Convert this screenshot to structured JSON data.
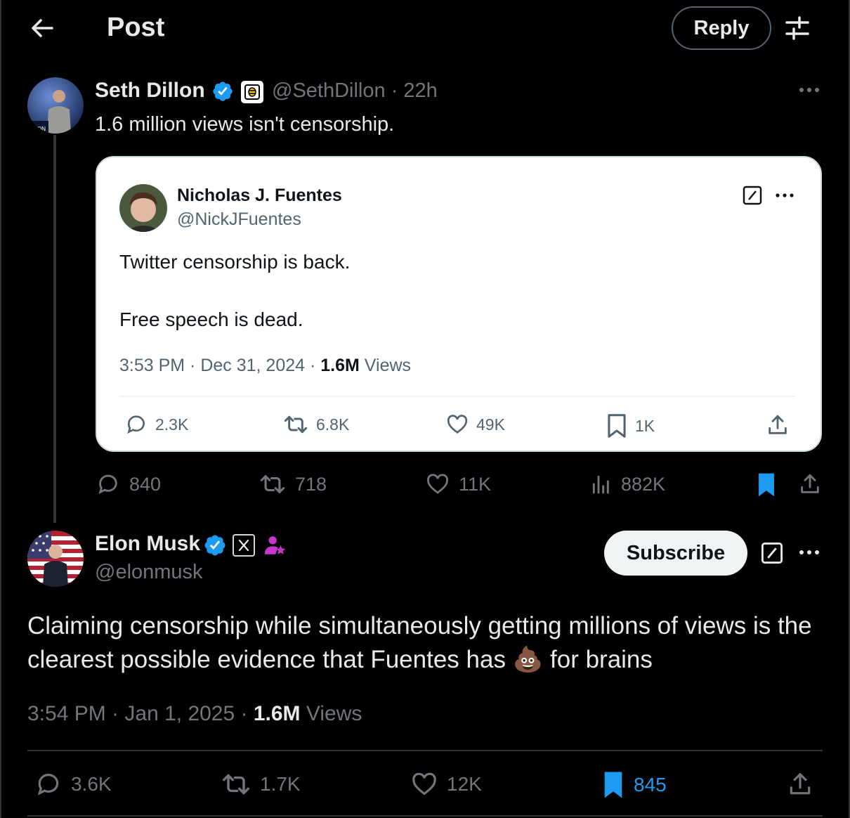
{
  "header": {
    "title": "Post",
    "reply_label": "Reply"
  },
  "parent_post": {
    "author_name": "Seth Dillon",
    "handle": "@SethDillon",
    "separator": "·",
    "time_ago": "22h",
    "text": "1.6 million views isn't censorship.",
    "stats": {
      "replies": "840",
      "reposts": "718",
      "likes": "11K",
      "views": "882K"
    }
  },
  "quoted_post": {
    "author_name": "Nicholas J. Fuentes",
    "handle": "@NickJFuentes",
    "line1": "Twitter censorship is back.",
    "line2": "Free speech is dead.",
    "timestamp": "3:53 PM · Dec 31, 2024 · ",
    "views_count": "1.6M",
    "views_label": " Views",
    "stats": {
      "replies": "2.3K",
      "reposts": "6.8K",
      "likes": "49K",
      "bookmarks": "1K"
    }
  },
  "main_post": {
    "author_name": "Elon Musk",
    "handle": "@elonmusk",
    "subscribe_label": "Subscribe",
    "text_line1": "Claiming censorship while simultaneously getting millions of views is the",
    "text_line2_before": "clearest possible evidence that Fuentes has ",
    "emoji": "💩",
    "text_line2_after": " for brains",
    "timestamp": "3:54 PM · Jan 1, 2025 · ",
    "views_count": "1.6M",
    "views_label": " Views",
    "stats": {
      "replies": "3.6K",
      "reposts": "1.7K",
      "likes": "12K",
      "bookmarks": "845"
    }
  },
  "colors": {
    "background": "#000000",
    "accent_blue": "#1d9bf0",
    "muted": "#71767b",
    "verified": "#1d9bf0",
    "affiliate_pink": "#c936cc"
  },
  "icons": [
    "back-arrow-icon",
    "filter-icon",
    "verified-badge-icon",
    "babylon-bee-icon",
    "x-logo-icon",
    "affiliate-icon",
    "more-icon",
    "grok-icon",
    "reply-icon",
    "repost-icon",
    "like-icon",
    "bookmark-icon",
    "views-icon",
    "share-icon"
  ]
}
